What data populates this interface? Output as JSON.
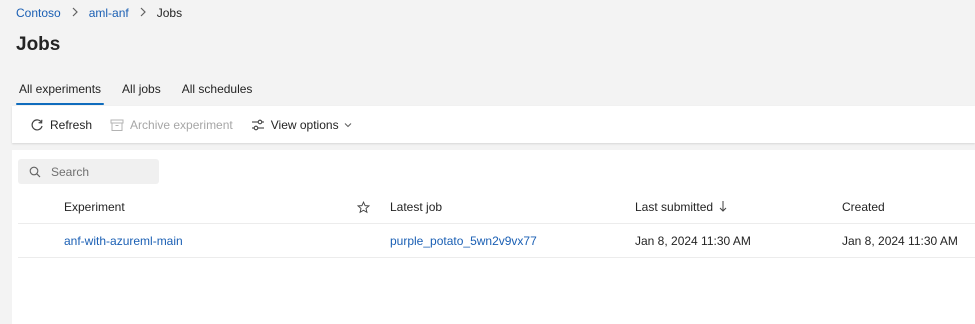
{
  "breadcrumb": {
    "items": [
      "Contoso",
      "aml-anf"
    ],
    "current": "Jobs"
  },
  "page": {
    "title": "Jobs"
  },
  "tabs": [
    {
      "label": "All experiments",
      "active": true
    },
    {
      "label": "All jobs",
      "active": false
    },
    {
      "label": "All schedules",
      "active": false
    }
  ],
  "toolbar": {
    "refresh_label": "Refresh",
    "archive_label": "Archive experiment",
    "view_options_label": "View options"
  },
  "search": {
    "placeholder": "Search"
  },
  "table": {
    "columns": {
      "experiment": "Experiment",
      "latest_job": "Latest job",
      "last_submitted": "Last submitted",
      "created": "Created"
    },
    "rows": [
      {
        "experiment": "anf-with-azureml-main",
        "latest_job": "purple_potato_5wn2v9vx77",
        "last_submitted": "Jan 8, 2024 11:30 AM",
        "created": "Jan 8, 2024 11:30 AM"
      }
    ]
  },
  "colors": {
    "link": "#1a5fb4",
    "accent": "#0f6cbd"
  },
  "icons": {
    "refresh": "refresh-icon",
    "archive": "archive-icon",
    "view_options": "sliders-icon",
    "search": "search-icon",
    "favorite": "star-icon",
    "sort": "sort-down-icon"
  }
}
